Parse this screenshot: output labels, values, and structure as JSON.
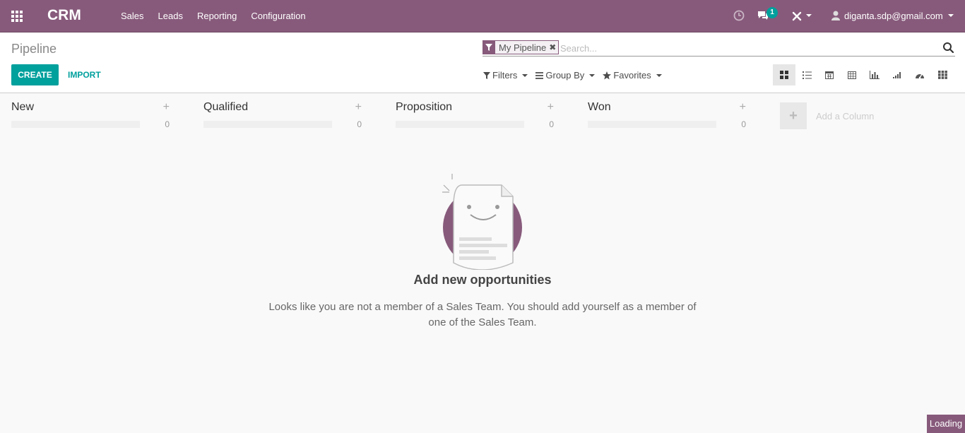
{
  "navbar": {
    "brand": "CRM",
    "menu": [
      "Sales",
      "Leads",
      "Reporting",
      "Configuration"
    ],
    "chat_count": "1",
    "user": "diganta.sdp@gmail.com",
    "color": "#875a7b"
  },
  "control": {
    "breadcrumb": "Pipeline",
    "facet": "My Pipeline",
    "search_placeholder": "Search...",
    "create": "CREATE",
    "import": "IMPORT",
    "filters": "Filters",
    "group_by": "Group By",
    "favorites": "Favorites",
    "views": [
      "kanban-view-icon",
      "list-view-icon",
      "calendar-view-icon",
      "pivot-view-icon",
      "graph-view-icon",
      "cohort-view-icon",
      "dashboard-view-icon",
      "grid-view-icon"
    ]
  },
  "kanban": {
    "columns": [
      {
        "title": "New",
        "count": "0"
      },
      {
        "title": "Qualified",
        "count": "0"
      },
      {
        "title": "Proposition",
        "count": "0"
      },
      {
        "title": "Won",
        "count": "0"
      }
    ],
    "add_column": "Add a Column"
  },
  "help": {
    "title": "Add new opportunities",
    "text": "Looks like you are not a member of a Sales Team. You should add yourself as a member of one of the Sales Team."
  },
  "loading": "Loading",
  "colors": {
    "primary": "#875a7b",
    "accent": "#00a09d"
  }
}
